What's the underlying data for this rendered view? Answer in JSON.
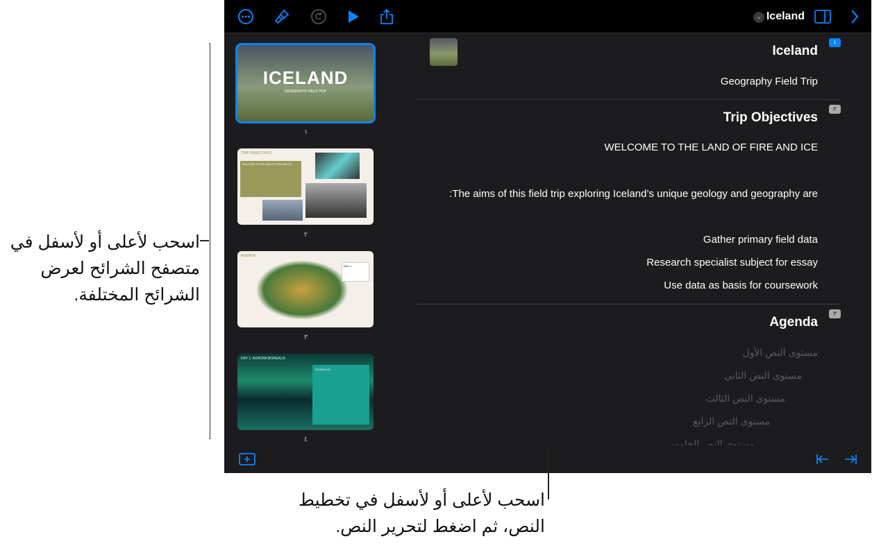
{
  "toolbar": {
    "icons": [
      "more-icon",
      "paintbrush-icon",
      "redo-icon",
      "play-icon",
      "share-icon"
    ],
    "doc_title": "Iceland",
    "accent": "#0a84ff"
  },
  "thumbnails": [
    {
      "number": "١",
      "title": "ICELAND",
      "subtitle": "GEOGRAPHY FIELD TRIP"
    },
    {
      "number": "٢",
      "title": "TRIP OBJECTIVES",
      "subtitle": "WELCOME TO THE LAND OF FIRE AND ICE"
    },
    {
      "number": "٣",
      "title": "AGENDA",
      "subtitle": "DAY 1"
    },
    {
      "number": "٤",
      "title": "DAY 1: AURORA BOREALIS",
      "subtitle": "SCHEDULE"
    }
  ],
  "outline": {
    "slides": [
      {
        "badge": "١",
        "title": "Iceland",
        "lines": [
          "Geography Field Trip"
        ]
      },
      {
        "badge": "٢",
        "title": "Trip Objectives",
        "lines": [
          "WELCOME TO THE LAND OF FIRE AND ICE",
          ":The aims of this field trip exploring Iceland’s unique geology and geography are",
          "Gather primary field data",
          "Research specialist subject for essay",
          "Use data as basis for coursework"
        ]
      },
      {
        "badge": "٣",
        "title": "Agenda",
        "lines": [
          "مستوى النص الأول",
          "مستوى النص الثاني",
          "مستوى النص الثالث",
          "مستوى النص الرابع",
          "مستوى النص الخامس"
        ]
      }
    ]
  },
  "callouts": {
    "left": "اسحب لأعلى أو لأسفل في متصفح الشرائح لعرض الشرائح المختلفة.",
    "bottom": "اسحب لأعلى أو لأسفل في تخطيط النص، ثم اضغط لتحرير النص."
  }
}
